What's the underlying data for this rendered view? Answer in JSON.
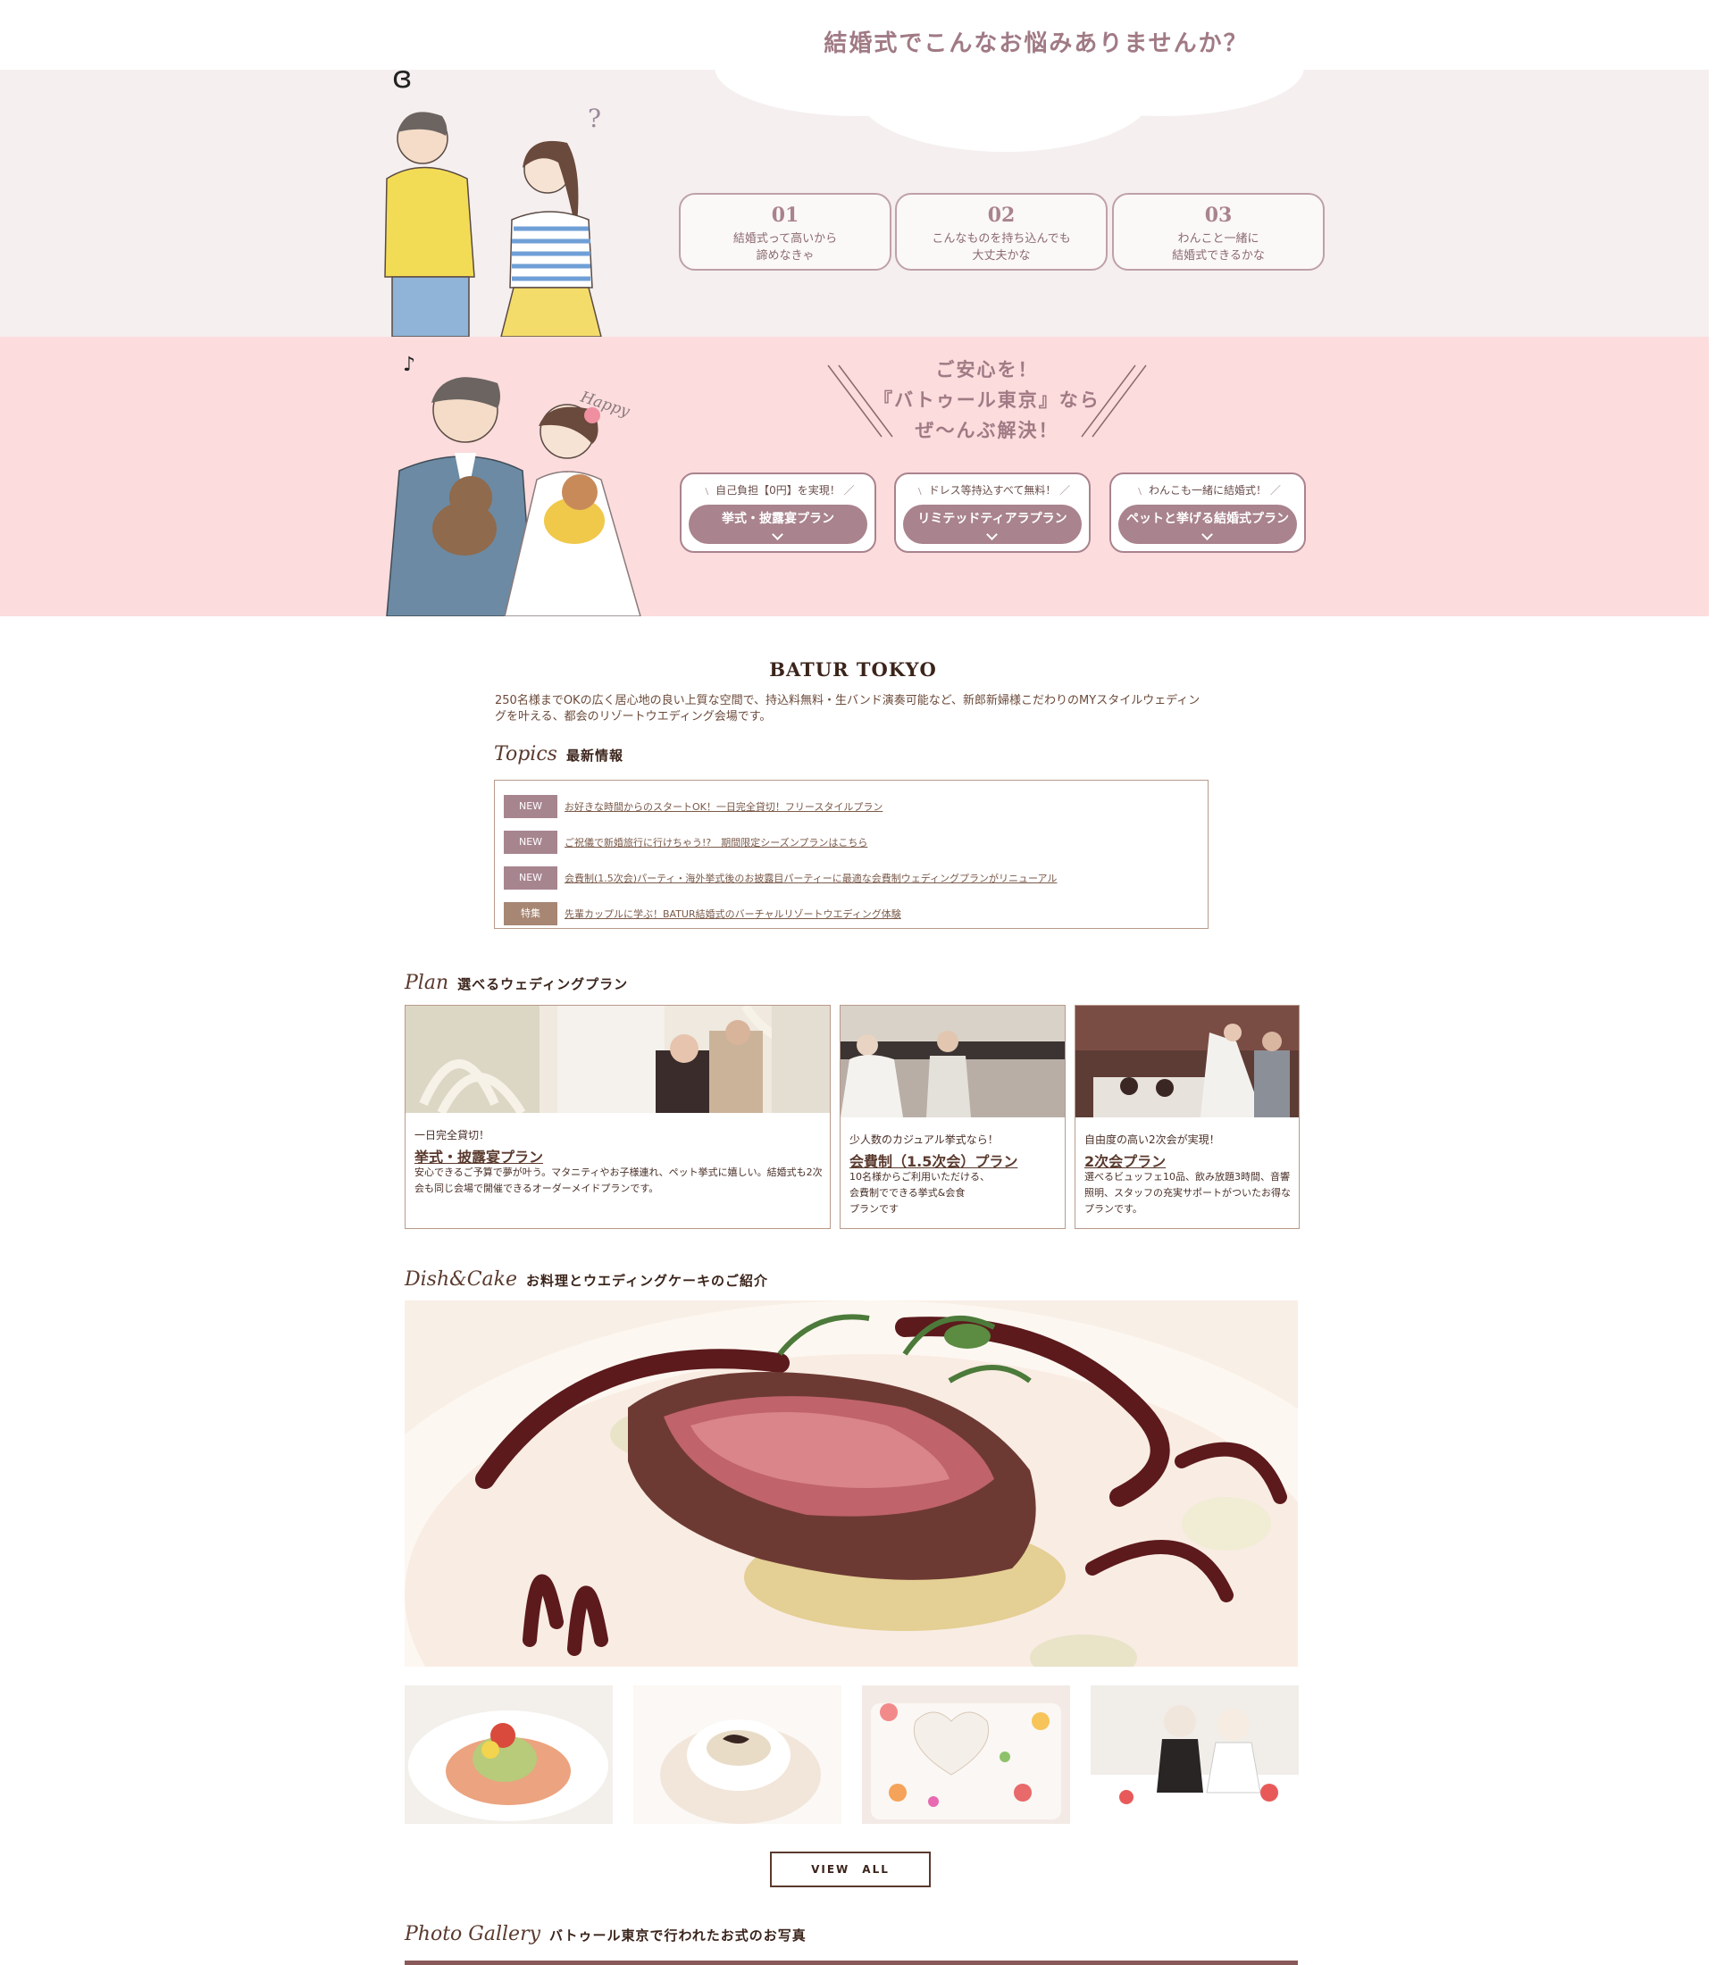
{
  "worries": {
    "title": "結婚式でこんなお悩みありませんか？",
    "cards": [
      {
        "num": "01",
        "text": "結婚式って高いから\n諦めなきゃ"
      },
      {
        "num": "02",
        "text": "こんなものを持ち込んでも\n大丈夫かな"
      },
      {
        "num": "03",
        "text": "わんこと一緒に\n結婚式できるかな"
      }
    ],
    "question_mark": "?"
  },
  "solution": {
    "title": "ご安心を！\n『バトゥール東京』なら\nぜ〜んぶ解決！",
    "happy": "Happy",
    "note": "♪",
    "plans": [
      {
        "caption": "自己負担【0円】を実現！",
        "button": "挙式・披露宴プラン"
      },
      {
        "caption": "ドレス等持込すべて無料！",
        "button": "リミテッドティアラプラン"
      },
      {
        "caption": "わんこも一緒に結婚式！",
        "button": "ペットと挙げる結婚式プラン"
      }
    ]
  },
  "intro": {
    "title": "BATUR TOKYO",
    "text": "250名様までOKの広く居心地の良い上質な空間で、持込料無料・生バンド演奏可能など、新郎新婦様こだわりのMYスタイルウェディングを叶える、都会のリゾートウエディング会場です。"
  },
  "topics": {
    "script": "Topics",
    "label": "最新情報",
    "items": [
      {
        "badge": "NEW",
        "text": "お好きな時間からのスタートOK！一日完全貸切！フリースタイルプラン"
      },
      {
        "badge": "NEW",
        "text": "ご祝儀で新婚旅行に行けちゃう!?　期間限定シーズンプランはこちら"
      },
      {
        "badge": "NEW",
        "text": "会費制(1.5次会)パーティ・海外挙式後のお披露目パーティーに最適な会費制ウェディングプランがリニューアル"
      },
      {
        "badge": "特集",
        "text": "先輩カップルに学ぶ！BATUR結婚式のバーチャルリゾートウエディング体験"
      }
    ]
  },
  "plans": {
    "script": "Plan",
    "label": "選べるウェディングプラン",
    "items": [
      {
        "sub": "一日完全貸切！",
        "name": "挙式・披露宴プラン",
        "desc": "安心できるご予算で夢が叶う。マタニティやお子様連れ、ペット挙式に嬉しい。結婚式も2次\n会も同じ会場で開催できるオーダーメイドプランです。"
      },
      {
        "sub": "少人数のカジュアル挙式なら！",
        "name": "会費制（1.5次会）プラン",
        "desc": "10名様からご利用いただける、\n会費制でできる挙式&会食\nプランです"
      },
      {
        "sub": "自由度の高い2次会が実現！",
        "name": "2次会プラン",
        "desc": "選べるビュッフェ10品、飲み放題3時間、音響\n照明、スタッフの充実サポートがついたお得な\nプランです。"
      }
    ]
  },
  "dish": {
    "script": "Dish&Cake",
    "label": "お料理とウエディングケーキのご紹介",
    "view_all": "VIEW　ALL"
  },
  "gallery": {
    "script": "Photo Gallery",
    "label": "バトゥール東京で行われたお式のお写真"
  }
}
